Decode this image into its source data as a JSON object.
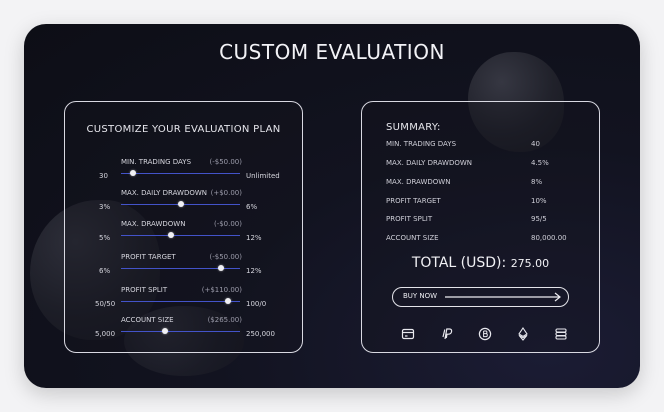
{
  "title": "CUSTOM EVALUATION",
  "customize": {
    "heading": "CUSTOMIZE YOUR EVALUATION PLAN",
    "sliders": [
      {
        "label": "MIN. TRADING DAYS",
        "delta": "(-$50.00)",
        "min": "30",
        "max": "Unlimited",
        "position": 0.1
      },
      {
        "label": "MAX. DAILY DRAWDOWN",
        "delta": "(+$0.00)",
        "min": "3%",
        "max": "6%",
        "position": 0.5
      },
      {
        "label": "MAX. DRAWDOWN",
        "delta": "(-$0.00)",
        "min": "5%",
        "max": "12%",
        "position": 0.42
      },
      {
        "label": "PROFIT TARGET",
        "delta": "(-$50.00)",
        "min": "6%",
        "max": "12%",
        "position": 0.84
      },
      {
        "label": "PROFIT SPLIT",
        "delta": "(+$110.00)",
        "min": "50/50",
        "max": "100/0",
        "position": 0.9
      },
      {
        "label": "ACCOUNT SIZE",
        "delta": "($265.00)",
        "min": "5,000",
        "max": "250,000",
        "position": 0.37
      }
    ]
  },
  "summary": {
    "heading": "SUMMARY:",
    "rows": [
      {
        "key": "MIN. TRADING DAYS",
        "value": "40"
      },
      {
        "key": "MAX. DAILY DRAWDOWN",
        "value": "4.5%"
      },
      {
        "key": "MAX. DRAWDOWN",
        "value": "8%"
      },
      {
        "key": "PROFIT TARGET",
        "value": "10%"
      },
      {
        "key": "PROFIT SPLIT",
        "value": "95/5"
      },
      {
        "key": "ACCOUNT SIZE",
        "value": "80,000.00"
      }
    ],
    "total_label": "TOTAL (USD):",
    "total_value": "275.00",
    "buy_label": "BUY NOW",
    "payment_icons": [
      "card-icon",
      "paypal-icon",
      "bitcoin-icon",
      "ethereum-icon",
      "crypto-stack-icon"
    ]
  },
  "colors": {
    "accent": "#4353c9",
    "background": "#121320",
    "panel_border": "#d9d9e2"
  }
}
